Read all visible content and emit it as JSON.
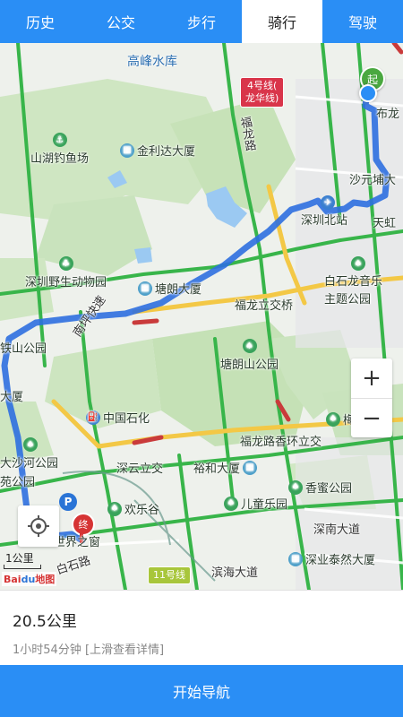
{
  "tabs": [
    {
      "label": "历史",
      "active": false
    },
    {
      "label": "公交",
      "active": false
    },
    {
      "label": "步行",
      "active": false
    },
    {
      "label": "骑行",
      "active": true
    },
    {
      "label": "驾驶",
      "active": false
    }
  ],
  "map": {
    "places": {
      "reservoir": "高峰水库",
      "fishing": "山湖钓鱼场",
      "building_jinlida": "金利达大厦",
      "shahe_line": "沙元埔大",
      "shenzhen_north": "深圳北站",
      "tianhong": "天虹",
      "zoo": "深圳野生动物园",
      "tanglang_building": "塘朗大厦",
      "baishilong": "白石龙音乐",
      "theme_park": "主题公园",
      "fulong_interchange": "福龙立交桥",
      "tieshan_park": "铁山公园",
      "tanglang_park": "塘朗山公园",
      "dasha_building": "大厦",
      "sinopec": "中国石化",
      "meilin_park": "梅林山公",
      "fulong_xianghuan": "福龙路香环立交",
      "dashahe_park": "大沙河公园",
      "yuan": "苑公园",
      "shenyun_interchange": "深云立交",
      "yuhe_building": "裕和大厦",
      "xiangmi_park": "香蜜公园",
      "happy_valley": "欢乐谷",
      "children_park": "儿童乐园",
      "window_world": "世界之窗",
      "shennan_avenue": "深南大道",
      "shenye_building": "深业泰然大厦",
      "binhai_avenue": "滨海大道",
      "baishi_road": "白石路",
      "fulong_road": "福龙路",
      "nanping_expressway": "南坪快速",
      "line_11": "11号线",
      "qiao": "桥",
      "ru": "布龙",
      "de": "德",
      "start_marker": "起",
      "end_marker": "终",
      "road_cluster": "龙公园"
    },
    "metro_badge": "4号线(\n龙华线)",
    "zoom_in": "+",
    "zoom_out": "−",
    "scale": "1公里",
    "logo_a": "Bai",
    "logo_b": "du",
    "logo_c": "地图"
  },
  "route": {
    "distance": "20.5公里",
    "duration": "1小时54分钟  [上滑查看详情]"
  },
  "nav_button": "开始导航",
  "colors": {
    "primary": "#2a8ef5",
    "route": "#2e6fe0",
    "green_road": "#33b24a",
    "yellow_road": "#f3c846",
    "red_road": "#c93b3b",
    "park": "#c9e3bd",
    "water": "#9bc9f2"
  }
}
